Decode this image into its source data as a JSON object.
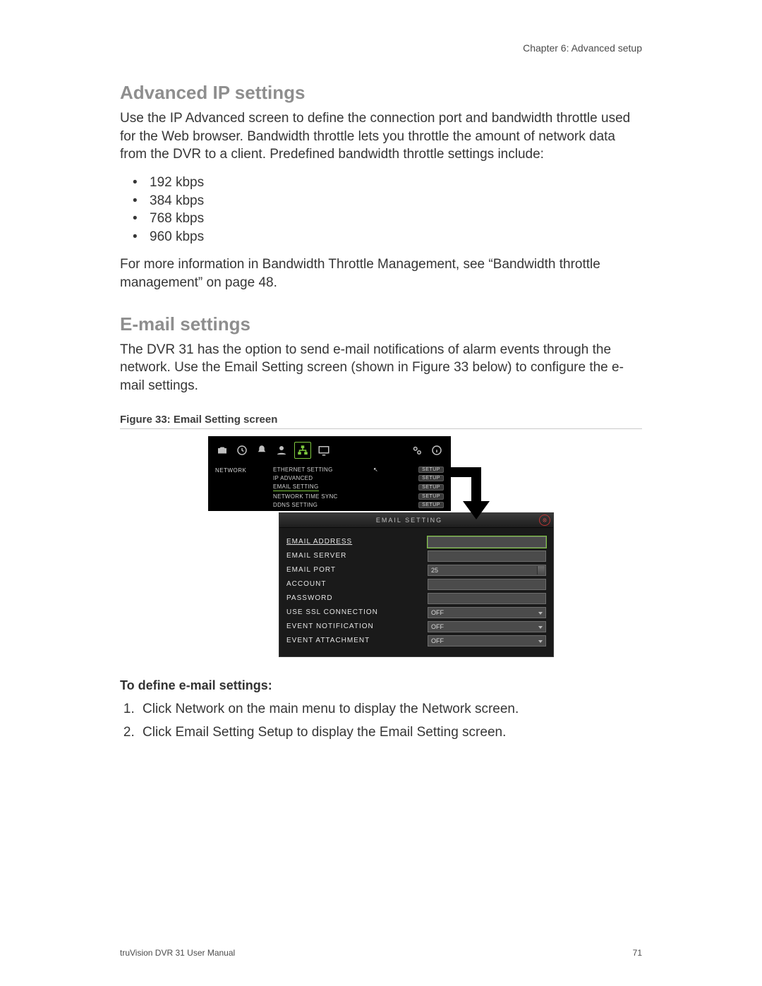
{
  "header": {
    "chapter": "Chapter 6: Advanced setup"
  },
  "sections": {
    "ip": {
      "title": "Advanced IP settings",
      "intro": "Use the IP Advanced screen to define the connection port and bandwidth throttle used for the Web browser. Bandwidth throttle lets you throttle the amount of network data from the DVR to a client. Predefined bandwidth throttle settings include:",
      "bullets": [
        "192 kbps",
        "384 kbps",
        "768 kbps",
        "960 kbps"
      ],
      "more": "For more information in Bandwidth Throttle Management, see “Bandwidth throttle management” on page 48."
    },
    "email": {
      "title": "E-mail settings",
      "intro": "The DVR 31 has the option to send e-mail notifications of alarm events through the network. Use the Email Setting screen (shown in Figure 33 below) to configure the e-mail settings.",
      "figcap": "Figure 33: Email Setting screen",
      "subhead": "To define e-mail settings:",
      "steps": [
        "Click Network on the main menu to display the Network screen.",
        "Click Email Setting Setup to display the Email Setting screen."
      ]
    }
  },
  "netmenu": {
    "tab": "NETWORK",
    "items": [
      {
        "label": "ETHERNET SETTING",
        "btn": "SETUP"
      },
      {
        "label": "IP ADVANCED",
        "btn": "SETUP"
      },
      {
        "label": "EMAIL SETTING",
        "btn": "SETUP"
      },
      {
        "label": "NETWORK TIME SYNC",
        "btn": "SETUP"
      },
      {
        "label": "DDNS SETTING",
        "btn": "SETUP"
      }
    ]
  },
  "emailwin": {
    "title": "EMAIL SETTING",
    "rows": [
      {
        "label": "EMAIL ADDRESS",
        "value": "",
        "type": "text",
        "hl": true
      },
      {
        "label": "EMAIL SERVER",
        "value": "",
        "type": "text"
      },
      {
        "label": "EMAIL PORT",
        "value": "25",
        "type": "spin"
      },
      {
        "label": "ACCOUNT",
        "value": "",
        "type": "text"
      },
      {
        "label": "PASSWORD",
        "value": "",
        "type": "text"
      },
      {
        "label": "USE SSL CONNECTION",
        "value": "OFF",
        "type": "drop"
      },
      {
        "label": "EVENT NOTIFICATION",
        "value": "OFF",
        "type": "drop"
      },
      {
        "label": "EVENT ATTACHMENT",
        "value": "OFF",
        "type": "drop"
      }
    ]
  },
  "footer": {
    "left": "truVision DVR 31 User Manual",
    "page": "71"
  }
}
